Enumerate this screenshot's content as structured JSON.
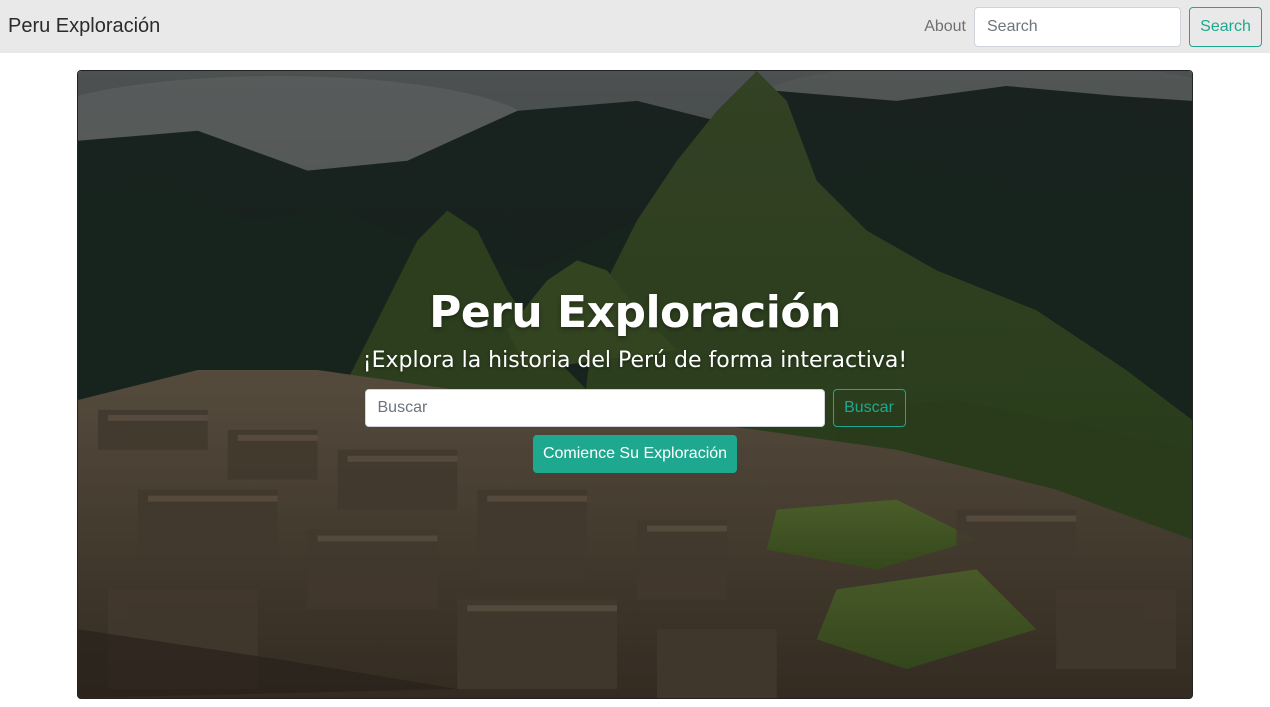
{
  "navbar": {
    "brand": "Peru Exploración",
    "about_link": "About",
    "search_placeholder": "Search",
    "search_button": "Search"
  },
  "hero": {
    "background": "machu-picchu-photo",
    "title": "Peru Exploración",
    "subtitle": "¡Explora la historia del Perú de forma interactiva!",
    "search_placeholder": "Buscar",
    "search_button": "Buscar",
    "cta_button": "Comience Su Exploración"
  },
  "colors": {
    "accent": "#1fa890",
    "navbar_bg": "#e9e9e9"
  }
}
